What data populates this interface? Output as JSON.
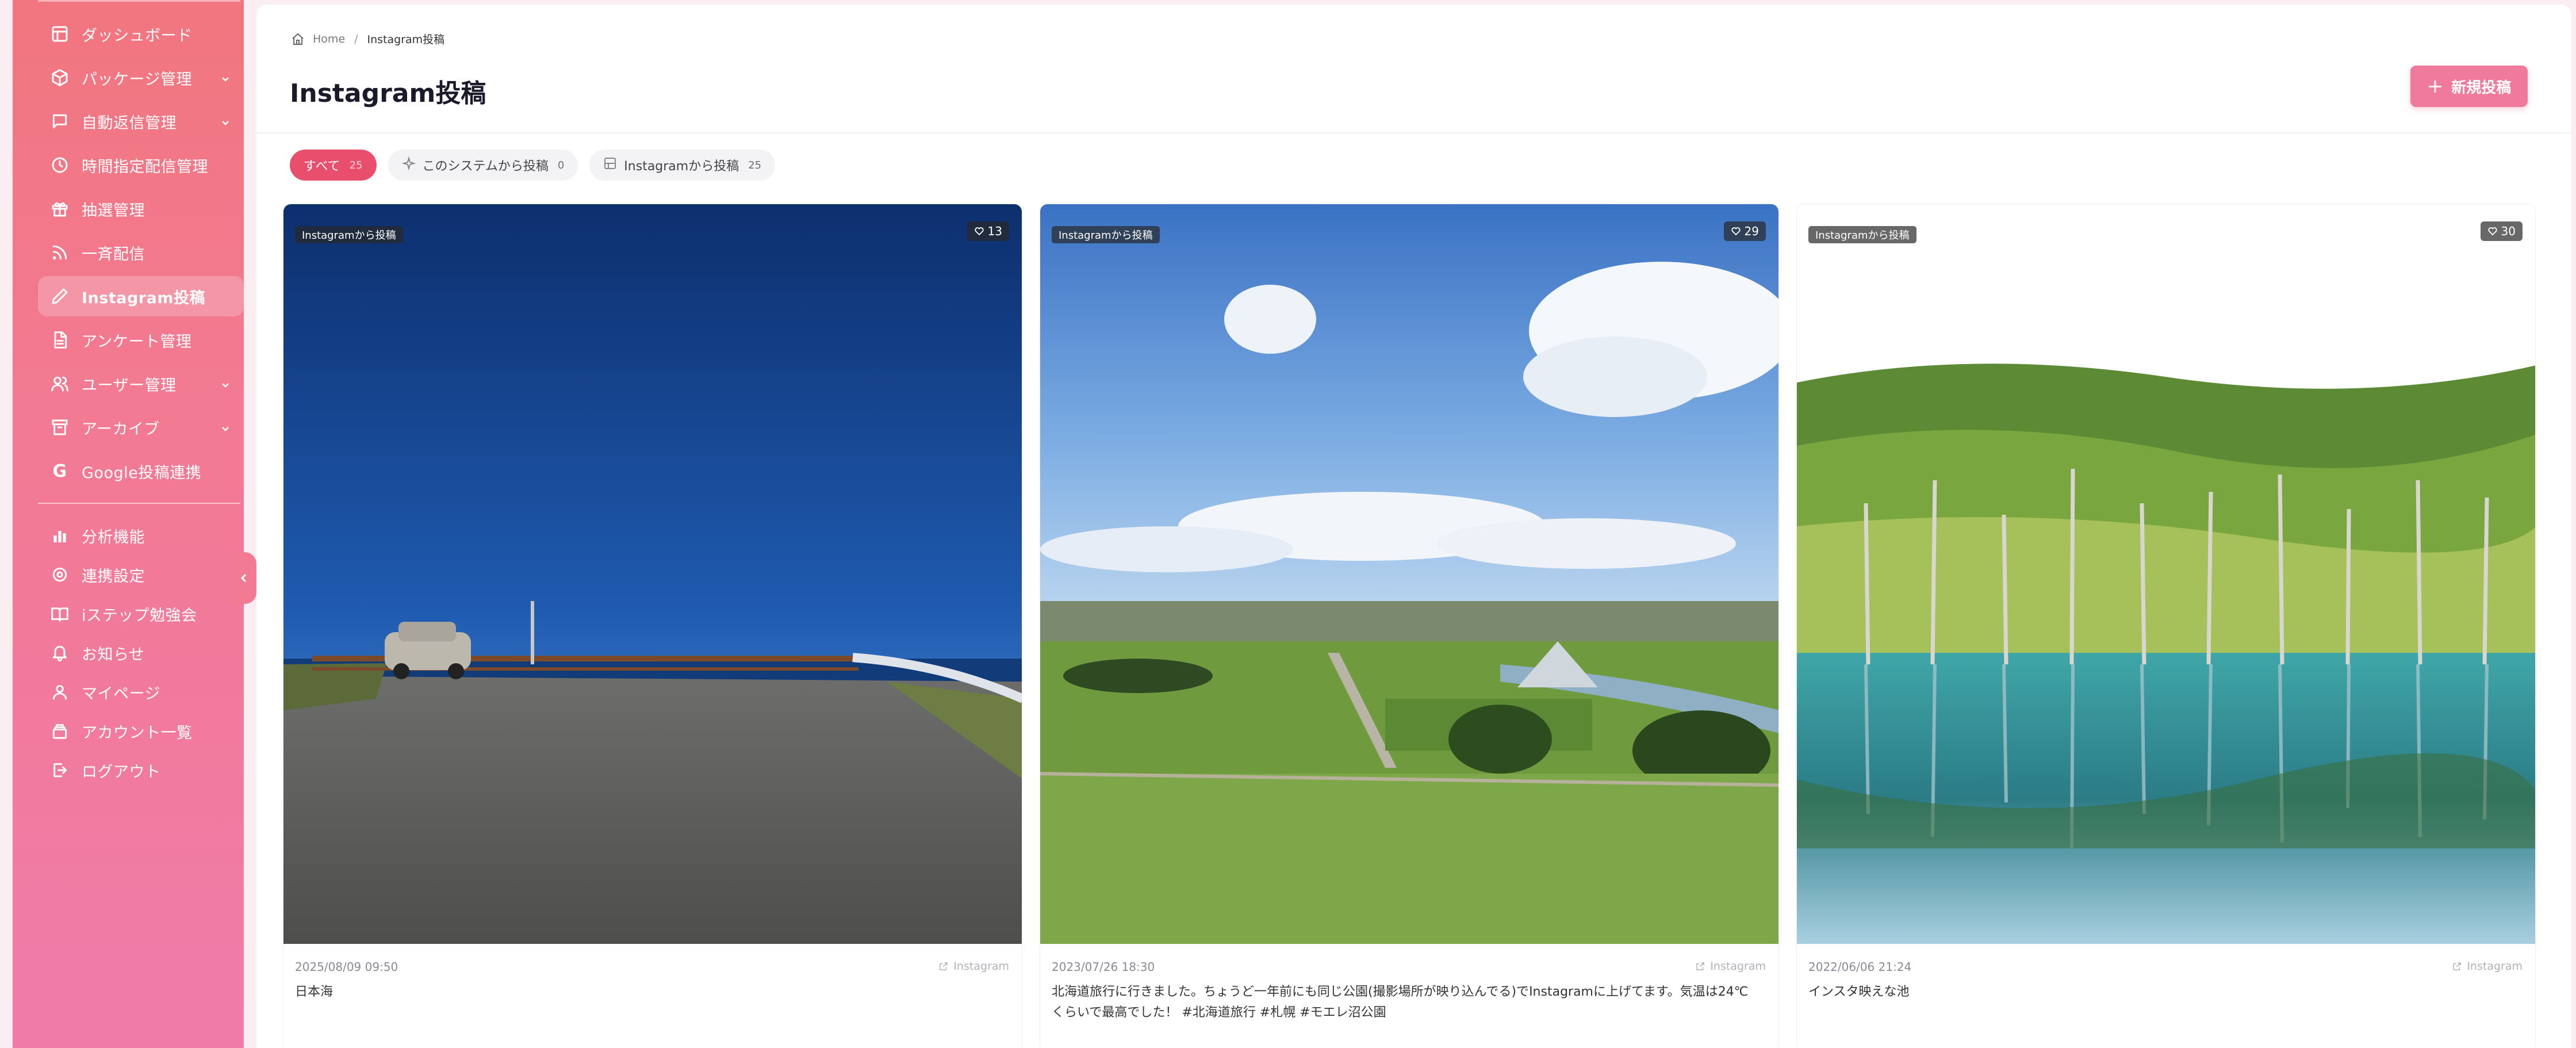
{
  "sidebar": {
    "items": [
      {
        "label": "ダッシュボード",
        "icon": "dashboard-icon",
        "has_chevron": false
      },
      {
        "label": "パッケージ管理",
        "icon": "package-icon",
        "has_chevron": true
      },
      {
        "label": "自動返信管理",
        "icon": "chat-icon",
        "has_chevron": true
      },
      {
        "label": "時間指定配信管理",
        "icon": "clock-icon",
        "has_chevron": false
      },
      {
        "label": "抽選管理",
        "icon": "gift-icon",
        "has_chevron": false
      },
      {
        "label": "一斉配信",
        "icon": "broadcast-icon",
        "has_chevron": false
      },
      {
        "label": "Instagram投稿",
        "icon": "pencil-icon",
        "has_chevron": false,
        "active": true
      },
      {
        "label": "アンケート管理",
        "icon": "document-icon",
        "has_chevron": false
      },
      {
        "label": "ユーザー管理",
        "icon": "users-icon",
        "has_chevron": true
      },
      {
        "label": "アーカイブ",
        "icon": "archive-icon",
        "has_chevron": true
      },
      {
        "label": "Google投稿連携",
        "icon": "google-icon",
        "has_chevron": false
      }
    ],
    "secondary_items": [
      {
        "label": "分析機能",
        "icon": "bar-chart-icon"
      },
      {
        "label": "連携設定",
        "icon": "settings-icon"
      },
      {
        "label": "iステップ勉強会",
        "icon": "book-icon"
      },
      {
        "label": "お知らせ",
        "icon": "bell-icon"
      },
      {
        "label": "マイページ",
        "icon": "user-icon"
      },
      {
        "label": "アカウント一覧",
        "icon": "accounts-icon"
      },
      {
        "label": "ログアウト",
        "icon": "logout-icon"
      }
    ]
  },
  "breadcrumb": {
    "home": "Home",
    "separator": "/",
    "current": "Instagram投稿"
  },
  "page": {
    "title": "Instagram投稿",
    "new_button": "新規投稿",
    "new_button_icon": "+"
  },
  "filters": [
    {
      "label": "すべて",
      "count": "25",
      "active": true
    },
    {
      "label": "このシステムから投稿",
      "count": "0",
      "icon": "sparkle-icon"
    },
    {
      "label": "Instagramから投稿",
      "count": "25",
      "icon": "image-icon"
    }
  ],
  "posts": [
    {
      "badge": "Instagramから投稿",
      "likes": "13",
      "date": "2025/08/09 09:50",
      "link": "Instagram",
      "caption": "日本海"
    },
    {
      "badge": "Instagramから投稿",
      "likes": "29",
      "date": "2023/07/26 18:30",
      "link": "Instagram",
      "caption": "北海道旅行に行きました。ちょうど一年前にも同じ公園(撮影場所が映り込んでる)でInstagramに上げてます。気温は24℃くらいで最高でした！ #北海道旅行 #札幌 #モエレ沼公園"
    },
    {
      "badge": "Instagramから投稿",
      "likes": "30",
      "date": "2022/06/06 21:24",
      "link": "Instagram",
      "caption": "インスタ映えな池"
    }
  ],
  "colors": {
    "sidebar_top": "#f1767f",
    "sidebar_bottom": "#f07ba9",
    "accent": "#e94e6d",
    "button": "#f07a9b"
  }
}
